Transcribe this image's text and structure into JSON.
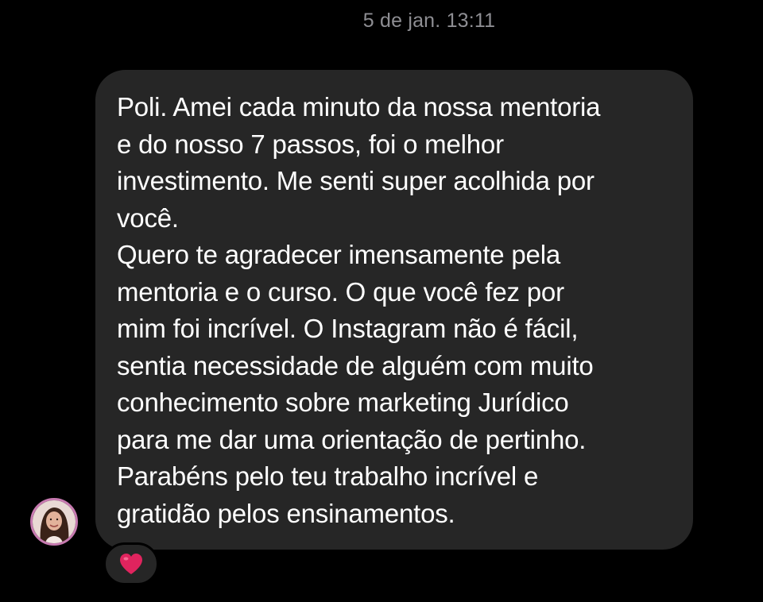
{
  "conversation": {
    "timestamp": "5 de jan. 13:11",
    "message": {
      "text": "Poli. Amei cada minuto da nossa mentoria\ne do nosso 7 passos, foi o melhor\ninvestimento. Me senti super acolhida por\nvocê.\nQuero te agradecer imensamente pela\nmentoria e o curso. O que você fez por\nmim foi incrível. O Instagram não é fácil,\nsentia necessidade de alguém com muito\nconhecimento sobre marketing Jurídico\npara me dar uma orientação de pertinho.\nParabéns pelo teu trabalho incrível e\ngratidão pelos ensinamentos.",
      "reaction": "heart-icon"
    },
    "sender_avatar": "profile-avatar"
  },
  "colors": {
    "background": "#000000",
    "bubble": "#262626",
    "text": "#ffffff",
    "timestamp": "#8e8e93",
    "avatar_ring": "#c77ab0",
    "heart": "#e0245e"
  }
}
